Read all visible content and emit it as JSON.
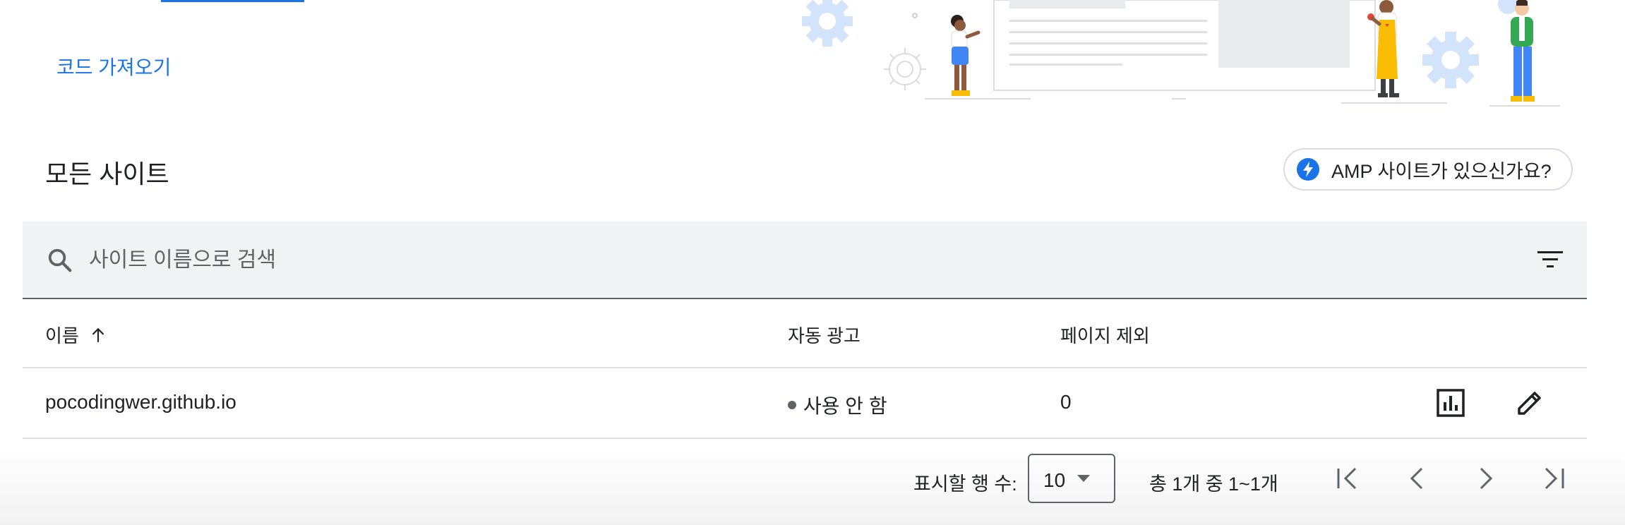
{
  "links": {
    "get_code": "코드 가져오기"
  },
  "section": {
    "title": "모든 사이트"
  },
  "amp_chip": {
    "label": "AMP 사이트가 있으신가요?"
  },
  "search": {
    "placeholder": "사이트 이름으로 검색",
    "value": ""
  },
  "table": {
    "columns": {
      "name": "이름",
      "auto_ads": "자동 광고",
      "page_exclusions": "페이지 제외"
    },
    "sort": {
      "column": "name",
      "direction": "ascending",
      "icon": "arrow-up-icon"
    },
    "rows": [
      {
        "name": "pocodingwer.github.io",
        "auto_ads": "사용 안 함",
        "page_exclusions": "0"
      }
    ]
  },
  "pagination": {
    "rows_label": "표시할 행 수:",
    "rows_value": "10",
    "range_text": "총 1개 중 1~1개"
  },
  "colors": {
    "accent": "#1a73e8",
    "text": "#202124",
    "muted": "#5f6368",
    "search_bg": "#f1f3f4",
    "divider": "#e0e0e0"
  },
  "icons": {
    "search": "search-icon",
    "filter": "filter-icon",
    "amp": "amp-bolt-icon",
    "report": "bar-chart-icon",
    "edit": "pencil-icon",
    "first": "first-page-icon",
    "prev": "chevron-left-icon",
    "next": "chevron-right-icon",
    "last": "last-page-icon",
    "dropdown": "caret-down-icon"
  }
}
